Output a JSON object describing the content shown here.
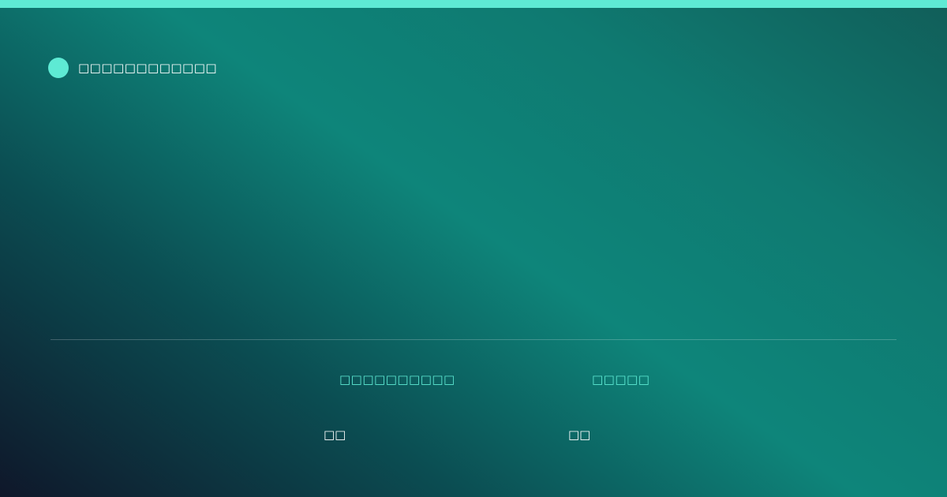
{
  "colors": {
    "accent": "#5eead4",
    "text": "#ffffff",
    "background_start": "#0f172a",
    "background_mid": "#0e857a",
    "background_end": "#115e59"
  },
  "brand": {
    "icon": "brand-dot-icon",
    "label": "□□□□□□□□□□□□"
  },
  "stats": [
    {
      "label": "□□□□□□□□□□",
      "value": "□□"
    },
    {
      "label": "□□□□□",
      "value": "□□"
    }
  ]
}
